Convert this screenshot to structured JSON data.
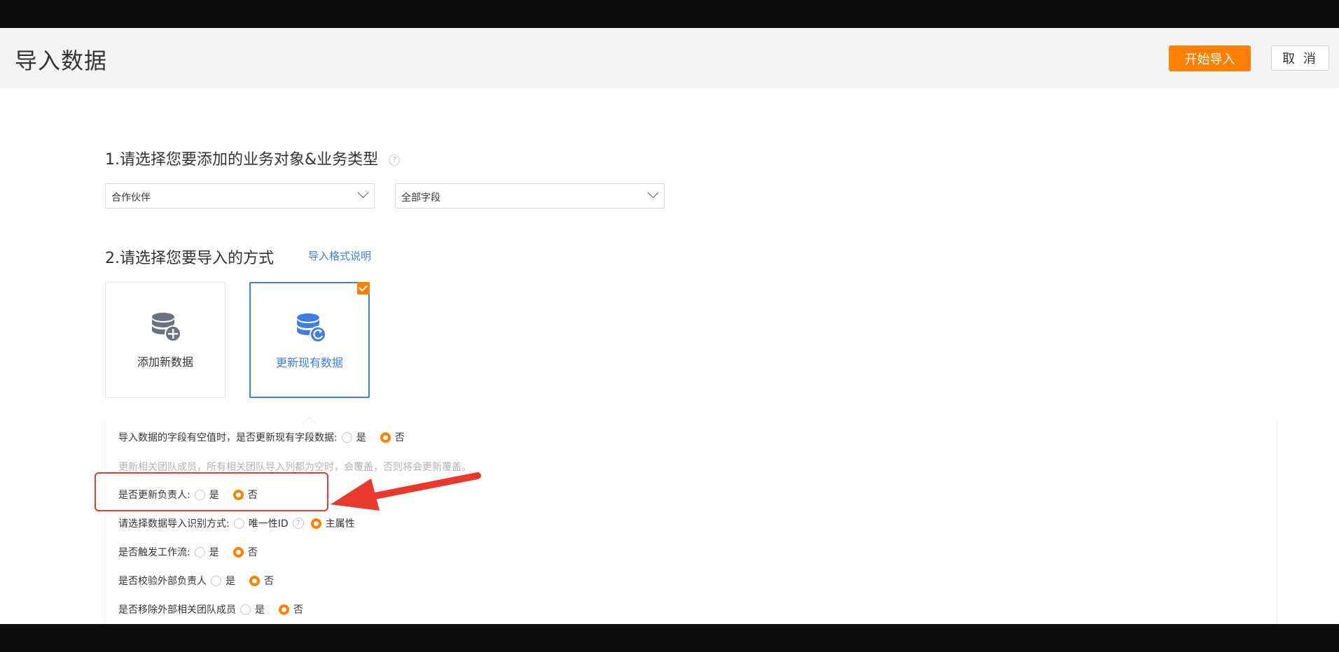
{
  "header": {
    "title": "导入数据",
    "start_button": "开始导入",
    "cancel_button": "取 消"
  },
  "step1": {
    "title": "1.请选择您要添加的业务对象&业务类型",
    "help": "?",
    "object_select": "合作伙伴",
    "type_select": "全部字段"
  },
  "step2": {
    "title": "2.请选择您要导入的方式",
    "format_link": "导入格式说明",
    "cards": [
      {
        "label": "添加新数据",
        "icon": "database-add-icon",
        "selected": false
      },
      {
        "label": "更新现有数据",
        "icon": "database-refresh-icon",
        "selected": true
      }
    ]
  },
  "options": {
    "empty_update": {
      "question": "导入数据的字段有空值时，是否更新现有字段数据:",
      "yes": "是",
      "no": "否",
      "selected": "否"
    },
    "team_note": "更新相关团队成员，所有相关团队导入列都为空时，会覆盖，否则将会更新覆盖。",
    "owner_update": {
      "question": "是否更新负责人:",
      "yes": "是",
      "no": "否",
      "selected": "否"
    },
    "identify_mode": {
      "question": "请选择数据导入识别方式:",
      "opt1": "唯一性ID",
      "opt2": "主属性",
      "selected": "主属性"
    },
    "trigger_workflow": {
      "question": "是否触发工作流:",
      "yes": "是",
      "no": "否",
      "selected": "否"
    },
    "check_external_owner": {
      "question": "是否校验外部负责人",
      "yes": "是",
      "no": "否",
      "selected": "否"
    },
    "remove_external_team": {
      "question": "是否移除外部相关团队成员",
      "yes": "是",
      "no": "否",
      "selected": "否"
    }
  },
  "colors": {
    "accent": "#ff8000",
    "link": "#3e7fe0",
    "annotation": "#e8392c"
  }
}
